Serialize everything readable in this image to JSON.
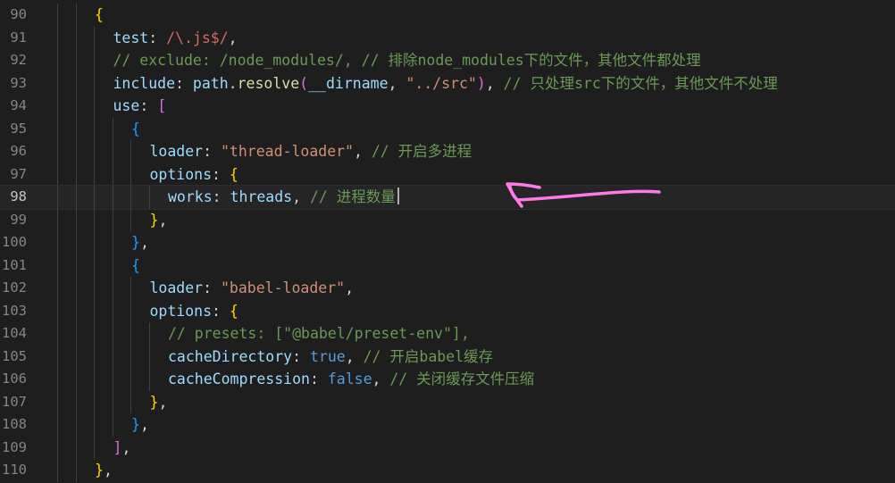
{
  "editor": {
    "current_line": "98",
    "lines": [
      {
        "num": "90",
        "indent": 2,
        "tokens": [
          {
            "t": "{",
            "c": "br1"
          }
        ]
      },
      {
        "num": "91",
        "indent": 3,
        "tokens": [
          {
            "t": "test",
            "c": "prop"
          },
          {
            "t": ": ",
            "c": "p"
          },
          {
            "t": "/\\.js$/",
            "c": "regex"
          },
          {
            "t": ",",
            "c": "p"
          }
        ]
      },
      {
        "num": "92",
        "indent": 3,
        "tokens": [
          {
            "t": "// exclude: /node_modules/, // 排除node_modules下的文件，其他文件都处理",
            "c": "com"
          }
        ]
      },
      {
        "num": "93",
        "indent": 3,
        "tokens": [
          {
            "t": "include",
            "c": "prop"
          },
          {
            "t": ": ",
            "c": "p"
          },
          {
            "t": "path",
            "c": "prop"
          },
          {
            "t": ".",
            "c": "p"
          },
          {
            "t": "resolve",
            "c": "fn"
          },
          {
            "t": "(",
            "c": "br2"
          },
          {
            "t": "__dirname",
            "c": "prop"
          },
          {
            "t": ", ",
            "c": "p"
          },
          {
            "t": "\"../src\"",
            "c": "str"
          },
          {
            "t": ")",
            "c": "br2"
          },
          {
            "t": ", ",
            "c": "p"
          },
          {
            "t": "// 只处理src下的文件，其他文件不处理",
            "c": "com"
          }
        ]
      },
      {
        "num": "94",
        "indent": 3,
        "tokens": [
          {
            "t": "use",
            "c": "prop"
          },
          {
            "t": ": ",
            "c": "p"
          },
          {
            "t": "[",
            "c": "br2"
          }
        ]
      },
      {
        "num": "95",
        "indent": 4,
        "tokens": [
          {
            "t": "{",
            "c": "br3"
          }
        ]
      },
      {
        "num": "96",
        "indent": 5,
        "tokens": [
          {
            "t": "loader",
            "c": "prop"
          },
          {
            "t": ": ",
            "c": "p"
          },
          {
            "t": "\"thread-loader\"",
            "c": "str"
          },
          {
            "t": ", ",
            "c": "p"
          },
          {
            "t": "// 开启多进程",
            "c": "com"
          }
        ]
      },
      {
        "num": "97",
        "indent": 5,
        "tokens": [
          {
            "t": "options",
            "c": "prop"
          },
          {
            "t": ": ",
            "c": "p"
          },
          {
            "t": "{",
            "c": "br1"
          }
        ]
      },
      {
        "num": "98",
        "indent": 6,
        "cursor": true,
        "tokens": [
          {
            "t": "works",
            "c": "prop"
          },
          {
            "t": ": ",
            "c": "p"
          },
          {
            "t": "threads",
            "c": "prop"
          },
          {
            "t": ", ",
            "c": "p"
          },
          {
            "t": "// 进程数量",
            "c": "com"
          }
        ]
      },
      {
        "num": "99",
        "indent": 5,
        "tokens": [
          {
            "t": "}",
            "c": "br1"
          },
          {
            "t": ",",
            "c": "p"
          }
        ]
      },
      {
        "num": "100",
        "indent": 4,
        "tokens": [
          {
            "t": "}",
            "c": "br3"
          },
          {
            "t": ",",
            "c": "p"
          }
        ]
      },
      {
        "num": "101",
        "indent": 4,
        "tokens": [
          {
            "t": "{",
            "c": "br3"
          }
        ]
      },
      {
        "num": "102",
        "indent": 5,
        "tokens": [
          {
            "t": "loader",
            "c": "prop"
          },
          {
            "t": ": ",
            "c": "p"
          },
          {
            "t": "\"babel-loader\"",
            "c": "str"
          },
          {
            "t": ",",
            "c": "p"
          }
        ]
      },
      {
        "num": "103",
        "indent": 5,
        "tokens": [
          {
            "t": "options",
            "c": "prop"
          },
          {
            "t": ": ",
            "c": "p"
          },
          {
            "t": "{",
            "c": "br1"
          }
        ]
      },
      {
        "num": "104",
        "indent": 6,
        "tokens": [
          {
            "t": "// presets: [\"@babel/preset-env\"],",
            "c": "com"
          }
        ]
      },
      {
        "num": "105",
        "indent": 6,
        "tokens": [
          {
            "t": "cacheDirectory",
            "c": "prop"
          },
          {
            "t": ": ",
            "c": "p"
          },
          {
            "t": "true",
            "c": "kw"
          },
          {
            "t": ", ",
            "c": "p"
          },
          {
            "t": "// 开启babel缓存",
            "c": "com"
          }
        ]
      },
      {
        "num": "106",
        "indent": 6,
        "tokens": [
          {
            "t": "cacheCompression",
            "c": "prop"
          },
          {
            "t": ": ",
            "c": "p"
          },
          {
            "t": "false",
            "c": "kw"
          },
          {
            "t": ", ",
            "c": "p"
          },
          {
            "t": "// 关闭缓存文件压缩",
            "c": "com"
          }
        ]
      },
      {
        "num": "107",
        "indent": 5,
        "tokens": [
          {
            "t": "}",
            "c": "br1"
          },
          {
            "t": ",",
            "c": "p"
          }
        ]
      },
      {
        "num": "108",
        "indent": 4,
        "tokens": [
          {
            "t": "}",
            "c": "br3"
          },
          {
            "t": ",",
            "c": "p"
          }
        ]
      },
      {
        "num": "109",
        "indent": 3,
        "tokens": [
          {
            "t": "]",
            "c": "br2"
          },
          {
            "t": ",",
            "c": "p"
          }
        ]
      },
      {
        "num": "110",
        "indent": 2,
        "tokens": [
          {
            "t": "}",
            "c": "br1"
          },
          {
            "t": ",",
            "c": "p"
          }
        ]
      }
    ]
  },
  "annotation": {
    "color": "#ff7ae6"
  }
}
